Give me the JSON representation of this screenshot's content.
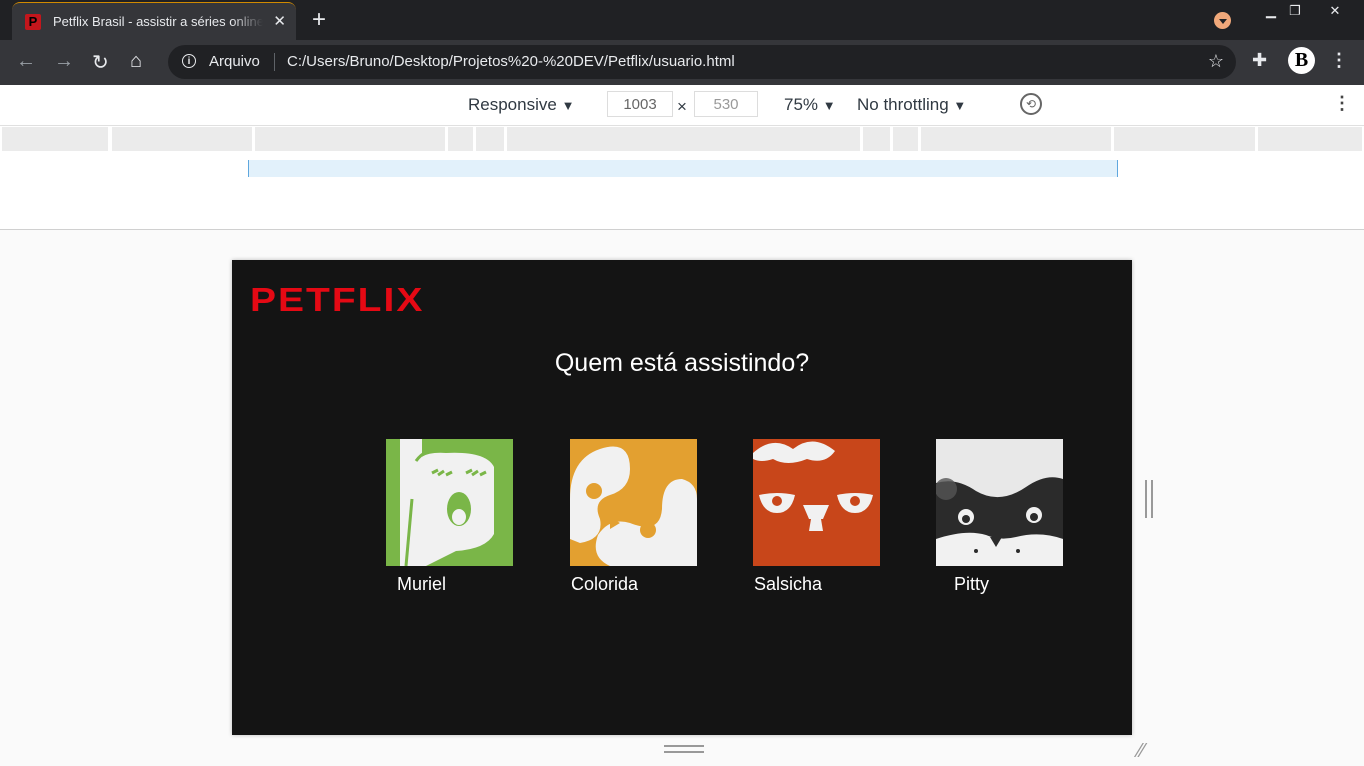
{
  "tab": {
    "title": "Petflix Brasil - assistir a séries online"
  },
  "address": {
    "scheme_label": "Arquivo",
    "url": "C:/Users/Bruno/Desktop/Projetos%20-%20DEV/Petflix/usuario.html"
  },
  "device_toolbar": {
    "device": "Responsive",
    "width": "1003",
    "times": "×",
    "height": "530",
    "zoom": "75%",
    "throttling": "No throttling"
  },
  "page": {
    "logo": "PETFLIX",
    "heading": "Quem está assistindo?",
    "profiles": [
      {
        "name": "Muriel",
        "color": "#7ab648"
      },
      {
        "name": "Colorida",
        "color": "#e3a030"
      },
      {
        "name": "Salsicha",
        "color": "#c8461a"
      },
      {
        "name": "Pitty",
        "color": "#e8e8e8"
      }
    ]
  },
  "colors": {
    "brand": "#e50914",
    "page_bg": "#141414"
  }
}
